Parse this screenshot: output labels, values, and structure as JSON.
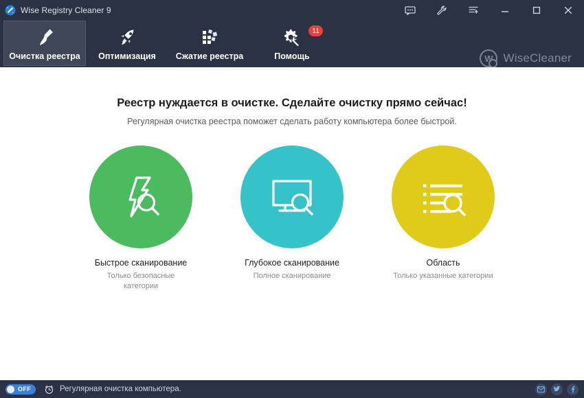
{
  "window": {
    "title": "Wise Registry Cleaner 9",
    "app_icon": "app-brush-icon",
    "controls": [
      {
        "name": "feedback-icon",
        "label": ""
      },
      {
        "name": "wrench-icon",
        "label": ""
      },
      {
        "name": "menu-icon",
        "label": ""
      },
      {
        "name": "minimize-icon",
        "label": ""
      },
      {
        "name": "maximize-icon",
        "label": ""
      },
      {
        "name": "close-icon",
        "label": ""
      }
    ]
  },
  "nav": {
    "tabs": [
      {
        "label": "Очистка реестра",
        "icon": "brush-icon",
        "active": true,
        "badge": ""
      },
      {
        "label": "Оптимизация",
        "icon": "rocket-icon",
        "active": false,
        "badge": ""
      },
      {
        "label": "Сжатие реестра",
        "icon": "squares-icon",
        "active": false,
        "badge": ""
      },
      {
        "label": "Помощь",
        "icon": "gear-wrench-icon",
        "active": false,
        "badge": "11"
      }
    ],
    "brand": {
      "mark": "W",
      "text": "WiseCleaner"
    }
  },
  "main": {
    "headline": "Реестр нуждается в очистке. Сделайте очистку прямо сейчас!",
    "subhead": "Регулярная очистка реестра поможет сделать работу компьютера более быстрой.",
    "options": [
      {
        "title": "Быстрое сканирование",
        "subtitle": "Только безопасные категории",
        "icon": "lightning-search-icon",
        "color": "#4cbb5f"
      },
      {
        "title": "Глубокое сканирование",
        "subtitle": "Полное сканирование",
        "icon": "monitor-search-icon",
        "color": "#35c2c8"
      },
      {
        "title": "Область",
        "subtitle": "Только указанные категории",
        "icon": "list-search-icon",
        "color": "#e0cb1a"
      }
    ]
  },
  "statusbar": {
    "toggle_state": "OFF",
    "clock_icon": "alarm-clock-icon",
    "text": "Регулярная очистка компьютера.",
    "social": [
      {
        "name": "email-icon"
      },
      {
        "name": "twitter-icon"
      },
      {
        "name": "facebook-icon"
      }
    ]
  },
  "colors": {
    "chrome": "#2b3243",
    "active_tab": "#3e4657",
    "badge": "#e8413a",
    "toggle": "#3e7fd6",
    "green": "#4cbb5f",
    "teal": "#35c2c8",
    "yellow": "#e0cb1a"
  }
}
